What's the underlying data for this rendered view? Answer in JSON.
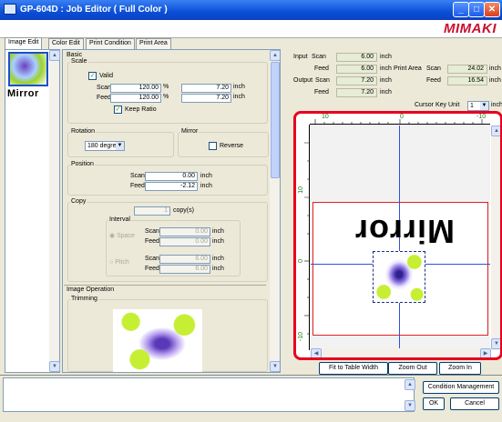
{
  "window": {
    "title": "GP-604D : Job Editor ( Full Color )",
    "brand": "MIMAKI"
  },
  "tabs": [
    "Image Edit",
    "Color Edit",
    "Print Condition",
    "Print Area"
  ],
  "thumbnail": {
    "label": "Mirror"
  },
  "basic": {
    "title": "Basic",
    "scale": {
      "title": "Scale",
      "valid_label": "Valid",
      "scan_label": "Scan",
      "feed_label": "Feed",
      "scan_pct": "120.00",
      "feed_pct": "120.00",
      "pct_unit": "%",
      "scan_inch": "7.20",
      "feed_inch": "7.20",
      "inch_unit": "inch",
      "keep_ratio_label": "Keep Ratio"
    },
    "rotation": {
      "title": "Rotation",
      "value": "180 degree"
    },
    "mirror": {
      "title": "Mirror",
      "reverse_label": "Reverse"
    },
    "position": {
      "title": "Position",
      "scan_label": "Scan",
      "feed_label": "Feed",
      "scan": "0.00",
      "feed": "-2.12",
      "unit": "inch"
    },
    "copy": {
      "title": "Copy",
      "count": "1",
      "count_unit": "copy(s)",
      "interval_title": "Interval",
      "space_label": "Space",
      "pitch_label": "Pitch",
      "scan_label": "Scan",
      "feed_label": "Feed",
      "space_scan": "0.00",
      "space_feed": "0.00",
      "pitch_scan": "6.00",
      "pitch_feed": "6.00",
      "unit": "inch"
    }
  },
  "image_operation": {
    "title": "Image Operation",
    "trimming_label": "Trimming"
  },
  "info": {
    "input_label": "Input",
    "output_label": "Output",
    "scan_label": "Scan",
    "feed_label": "Feed",
    "input_scan": "6.00",
    "input_feed": "6.00",
    "output_scan": "7.20",
    "output_feed": "7.20",
    "unit": "inch",
    "print_area_label": "Print Area",
    "pa_scan_label": "Scan",
    "pa_feed_label": "Feed",
    "pa_scan": "24.02",
    "pa_feed": "16.54",
    "cursor_key_label": "Cursor Key Unit",
    "cursor_key_value": "1",
    "cursor_key_unit": "inch"
  },
  "ruler": {
    "top_labels": [
      "10",
      "0",
      "-10"
    ],
    "side_labels": [
      "10",
      "0",
      "-10"
    ]
  },
  "preview_text": "Mirror",
  "preview_buttons": {
    "fit": "Fit to Table Width",
    "zoom_out": "Zoom Out",
    "zoom_in": "Zoom In"
  },
  "bottom_buttons": {
    "condition": "Condition Management",
    "ok": "OK",
    "cancel": "Cancel"
  },
  "colors": {
    "accent_red": "#e8001f",
    "title_blue": "#0a4fd6",
    "guide_blue": "#3050e0",
    "guide_red": "#e02020"
  }
}
